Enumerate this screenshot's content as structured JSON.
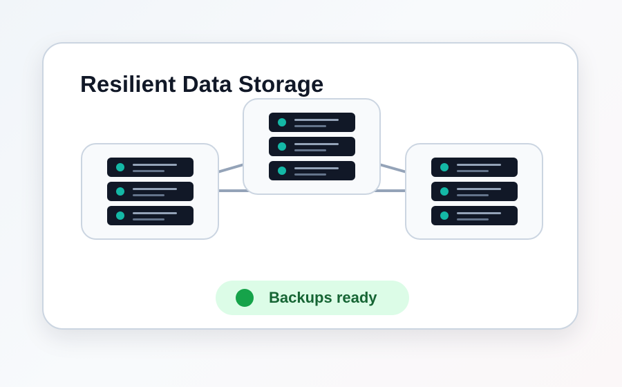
{
  "card": {
    "title": "Resilient Data Storage"
  },
  "nodes": [
    {
      "id": "left",
      "servers": 3
    },
    {
      "id": "center",
      "servers": 3
    },
    {
      "id": "right",
      "servers": 3
    }
  ],
  "status": {
    "label": "Backups ready",
    "color": "#16a34a",
    "background": "#dcfce7"
  },
  "colors": {
    "server": "#111827",
    "server_led": "#14b8a6",
    "link": "#94a3b8",
    "node_border": "#cbd5e1"
  },
  "icons": {
    "server": "server-rack-icon",
    "status": "status-dot-icon"
  }
}
